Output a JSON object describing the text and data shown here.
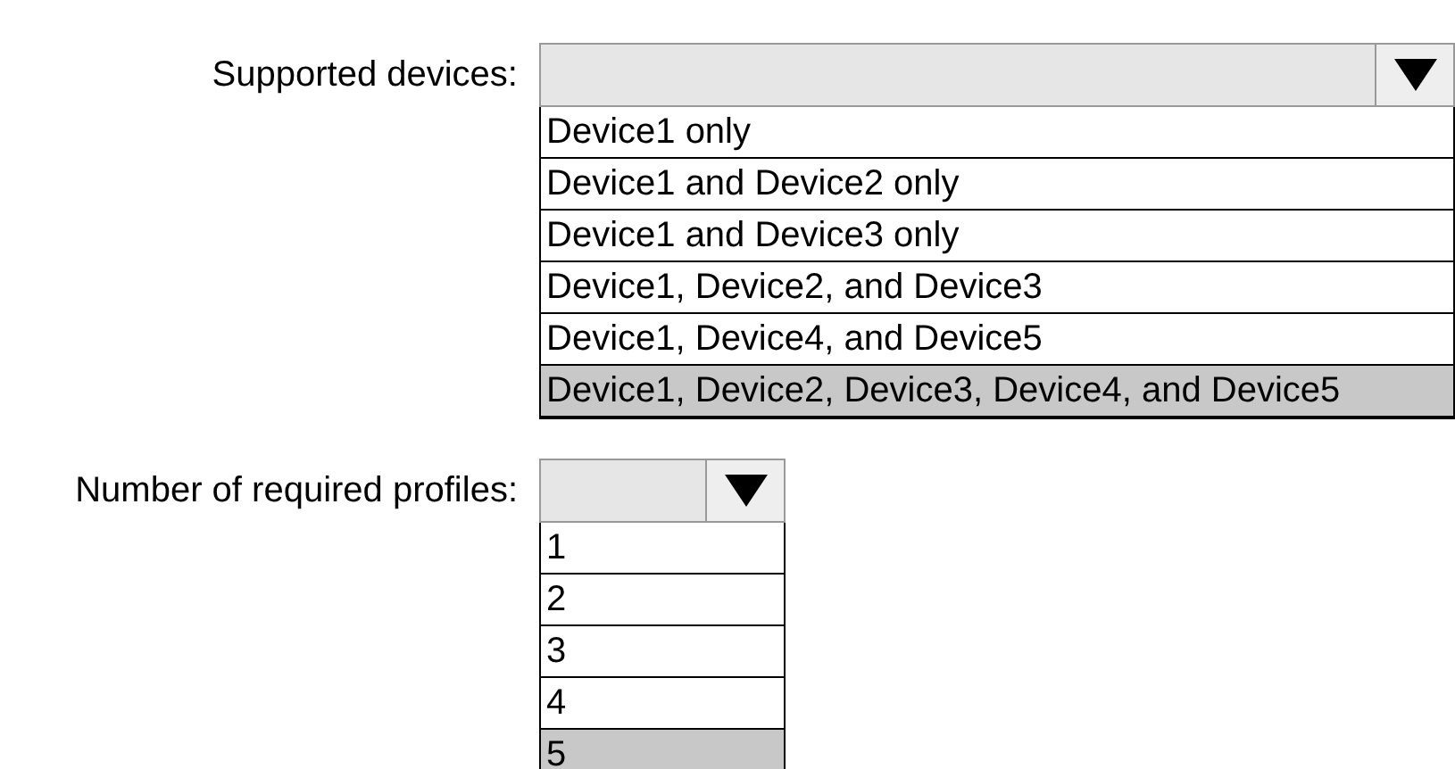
{
  "dropdowns": [
    {
      "label": "Supported devices:",
      "options": [
        {
          "text": "Device1 only",
          "selected": false
        },
        {
          "text": "Device1 and Device2 only",
          "selected": false
        },
        {
          "text": "Device1 and Device3 only",
          "selected": false
        },
        {
          "text": "Device1, Device2, and Device3",
          "selected": false
        },
        {
          "text": "Device1, Device4, and Device5",
          "selected": false
        },
        {
          "text": "Device1, Device2, Device3, Device4, and Device5",
          "selected": true
        }
      ]
    },
    {
      "label": "Number of required profiles:",
      "options": [
        {
          "text": "1",
          "selected": false
        },
        {
          "text": "2",
          "selected": false
        },
        {
          "text": "3",
          "selected": false
        },
        {
          "text": "4",
          "selected": false
        },
        {
          "text": "5",
          "selected": true
        }
      ]
    }
  ]
}
